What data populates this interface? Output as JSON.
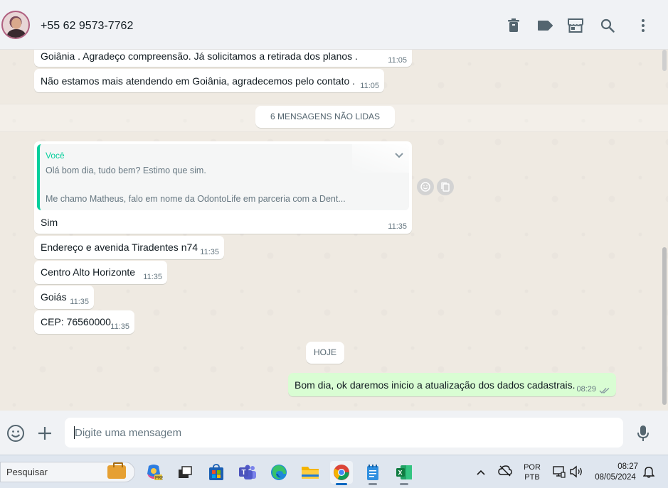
{
  "header": {
    "contact_name": "+55 62 9573-7762",
    "icons": [
      "trash-icon",
      "label-icon",
      "store-icon",
      "search-icon",
      "menu-icon"
    ]
  },
  "messages": {
    "m1": {
      "text": "Goiânia . Agradeço compreensão.  Já solicitamos a retirada dos planos .",
      "time": "11:05"
    },
    "m2": {
      "text": "Não estamos mais atendendo em Goiânia, agradecemos pelo contato .",
      "time": "11:05"
    },
    "unread_label": "6 MENSAGENS NÃO LIDAS",
    "reply": {
      "quote_author": "Você",
      "quote_line1": "Olá bom dia, tudo bem? Estimo que sim.",
      "quote_line2": "Me chamo Matheus, falo em nome da OdontoLife em parceria com a Dent...",
      "text": "Sim",
      "time": "11:35"
    },
    "m4": {
      "text": "Endereço e avenida Tiradentes n74",
      "time": "11:35"
    },
    "m5": {
      "text": "Centro Alto Horizonte",
      "time": "11:35"
    },
    "m6": {
      "text": "Goiás",
      "time": "11:35"
    },
    "m7": {
      "text": "CEP: 76560000",
      "time": "11:35"
    },
    "today_label": "HOJE",
    "out1": {
      "text": "Bom dia, ok daremos inicio a atualização dos dados cadastrais.",
      "time": "08:29",
      "status": "read"
    }
  },
  "composer": {
    "placeholder": "Digite uma mensagem"
  },
  "taskbar": {
    "search_label": "Pesquisar",
    "language_top": "POR",
    "language_bottom": "PTB",
    "clock_time": "08:27",
    "clock_date": "08/05/2024",
    "apps": [
      "copilot-icon",
      "task-view-icon",
      "store-app-icon",
      "teams-icon",
      "edge-icon",
      "file-explorer-icon",
      "chrome-icon",
      "notepad-icon",
      "excel-icon"
    ]
  },
  "colors": {
    "outgoing_bubble": "#d9fdd3",
    "quote_accent": "#06cf9c",
    "chat_bg": "#efeae2"
  }
}
